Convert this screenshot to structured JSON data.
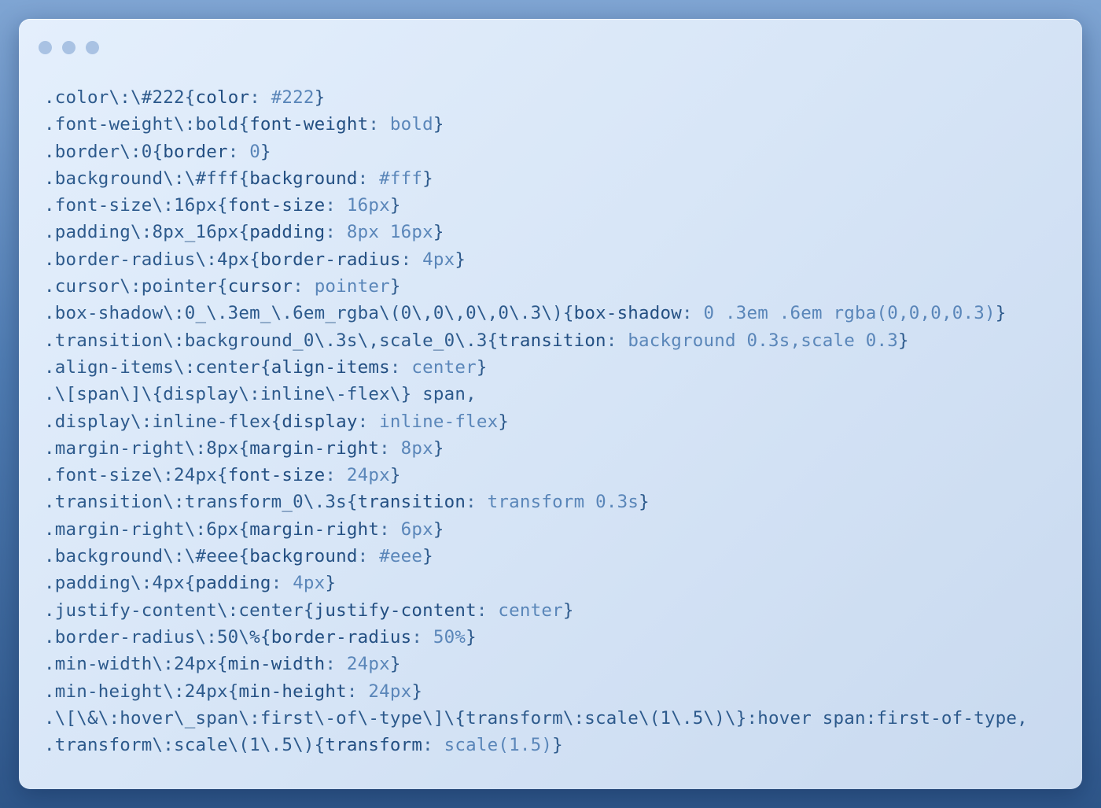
{
  "window": {
    "controls": [
      "close",
      "minimize",
      "maximize"
    ]
  },
  "code_lines": [
    {
      "selector": ".color\\:\\#222",
      "property": "color",
      "value": "#222"
    },
    {
      "selector": ".font-weight\\:bold",
      "property": "font-weight",
      "value": "bold"
    },
    {
      "selector": ".border\\:0",
      "property": "border",
      "value": "0"
    },
    {
      "selector": ".background\\:\\#fff",
      "property": "background",
      "value": "#fff"
    },
    {
      "selector": ".font-size\\:16px",
      "property": "font-size",
      "value": "16px"
    },
    {
      "selector": ".padding\\:8px_16px",
      "property": "padding",
      "value": "8px 16px"
    },
    {
      "selector": ".border-radius\\:4px",
      "property": "border-radius",
      "value": "4px"
    },
    {
      "selector": ".cursor\\:pointer",
      "property": "cursor",
      "value": "pointer"
    },
    {
      "selector": ".box-shadow\\:0_\\.3em_\\.6em_rgba\\(0\\,0\\,0\\,0\\.3\\)",
      "property": "box-shadow",
      "value": "0 .3em .6em rgba(0,0,0,0.3)"
    },
    {
      "selector": ".transition\\:background_0\\.3s\\,scale_0\\.3",
      "property": "transition",
      "value": "background 0.3s,scale 0.3"
    },
    {
      "selector": ".align-items\\:center",
      "property": "align-items",
      "value": "center"
    },
    {
      "text": ".\\[span\\]\\{display\\:inline\\-flex\\} span,"
    },
    {
      "selector": ".display\\:inline-flex",
      "property": "display",
      "value": "inline-flex"
    },
    {
      "selector": ".margin-right\\:8px",
      "property": "margin-right",
      "value": "8px"
    },
    {
      "selector": ".font-size\\:24px",
      "property": "font-size",
      "value": "24px"
    },
    {
      "selector": ".transition\\:transform_0\\.3s",
      "property": "transition",
      "value": "transform 0.3s"
    },
    {
      "selector": ".margin-right\\:6px",
      "property": "margin-right",
      "value": "6px"
    },
    {
      "selector": ".background\\:\\#eee",
      "property": "background",
      "value": "#eee"
    },
    {
      "selector": ".padding\\:4px",
      "property": "padding",
      "value": "4px"
    },
    {
      "selector": ".justify-content\\:center",
      "property": "justify-content",
      "value": "center"
    },
    {
      "selector": ".border-radius\\:50\\%",
      "property": "border-radius",
      "value": "50%"
    },
    {
      "selector": ".min-width\\:24px",
      "property": "min-width",
      "value": "24px"
    },
    {
      "selector": ".min-height\\:24px",
      "property": "min-height",
      "value": "24px"
    },
    {
      "text": ".\\[\\&\\:hover\\_span\\:first\\-of\\-type\\]\\{transform\\:scale\\(1\\.5\\)\\}:hover span:first-of-type,"
    },
    {
      "selector": ".transform\\:scale\\(1\\.5\\)",
      "property": "transform",
      "value": "scale(1.5)"
    }
  ],
  "colors": {
    "background_top": "#7fa5d3",
    "background_bottom": "#2e5689",
    "window": "#dce9f8",
    "window_dots": "#a9c2e3",
    "selector": "#2d5a8c",
    "property": "#234f82",
    "value": "#5a86b9"
  }
}
